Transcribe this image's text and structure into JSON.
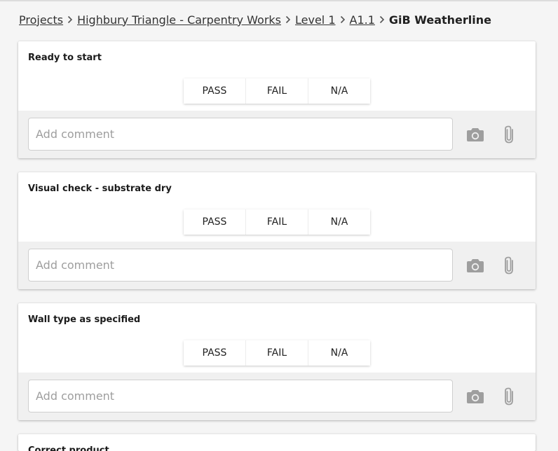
{
  "breadcrumb": {
    "items": [
      "Projects",
      "Highbury Triangle - Carpentry Works",
      "Level 1",
      "A1.1"
    ],
    "current": "GiB Weatherline"
  },
  "buttons": {
    "pass": "PASS",
    "fail": "FAIL",
    "na": "N/A"
  },
  "comment_placeholder": "Add comment",
  "checks": [
    {
      "title": "Ready to start"
    },
    {
      "title": "Visual check - substrate dry"
    },
    {
      "title": "Wall type as specified"
    },
    {
      "title": "Correct product"
    }
  ],
  "colors": {
    "icon": "#9e9e9e",
    "comment_bg": "#f0f0f0",
    "page_bg": "#f5f5f5"
  }
}
